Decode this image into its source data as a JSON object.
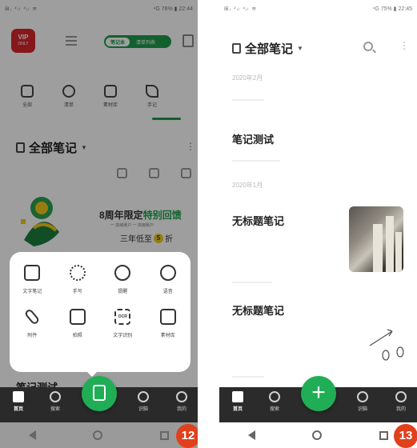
{
  "left": {
    "status": {
      "signal": "⊞ᵢ ⁴ᵢₗ ⁴ᵢₗ ≋",
      "right": "⁴G 76% ▮ 22:44"
    },
    "vip": {
      "title": "VIP",
      "sub": "ONLY"
    },
    "toggle": {
      "on_label": "笔记本",
      "off_label": "清单列表"
    },
    "categories": [
      {
        "label": "全部"
      },
      {
        "label": "清单"
      },
      {
        "label": "素材库"
      },
      {
        "label": "手记"
      }
    ],
    "notebook_title": "全部笔记",
    "promo": {
      "line1_prefix": "8周年限定",
      "line1_highlight": "特别回馈",
      "line2": "一 高级账户    一 高级账户",
      "line3_prefix": "三年低至",
      "line3_num": "5",
      "line3_suffix": "折"
    },
    "popup_items": [
      {
        "label": "文字笔记"
      },
      {
        "label": "手写"
      },
      {
        "label": "提醒"
      },
      {
        "label": "语音"
      },
      {
        "label": "附件"
      },
      {
        "label": "拍照"
      },
      {
        "label": "文字识别",
        "glyph": "OCR"
      },
      {
        "label": "素材库"
      }
    ],
    "peek_text": "笔记测试",
    "nav": [
      {
        "label": "首页"
      },
      {
        "label": "搜索"
      },
      {
        "label": ""
      },
      {
        "label": "识脑"
      },
      {
        "label": "我的"
      }
    ],
    "badge": "12"
  },
  "right": {
    "status": {
      "signal": "⊞ᵢ ⁴ᵢₗ ⁴ᵢₗ ≋",
      "right": "⁴G 75% ▮ 22:45"
    },
    "notebook_title": "全部笔记",
    "groups": [
      {
        "date": "2020年2月",
        "notes": [
          {
            "title": "笔记测试"
          }
        ]
      },
      {
        "date": "2020年1月",
        "notes": [
          {
            "title": "无标题笔记"
          },
          {
            "title": "无标题笔记"
          }
        ]
      }
    ],
    "nav": [
      {
        "label": "首页"
      },
      {
        "label": "搜索"
      },
      {
        "label": "+"
      },
      {
        "label": "识脑"
      },
      {
        "label": "我的"
      }
    ],
    "badge": "13"
  },
  "colors": {
    "accent": "#1fae55",
    "badge": "#e0401c",
    "vip": "#d8262c"
  }
}
